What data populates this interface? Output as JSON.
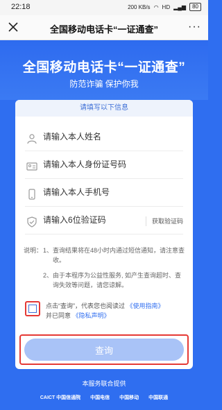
{
  "status": {
    "time": "22:18",
    "speed": "200 KB/s",
    "signal": "HD",
    "battery": "80"
  },
  "nav": {
    "title": "全国移动电话卡“一证通查”",
    "more": "···"
  },
  "hero": {
    "title": "全国移动电话卡“一证通查”",
    "subtitle": "防范诈骗 保护你我"
  },
  "form": {
    "header": "请填写以下信息",
    "name_placeholder": "请输入本人姓名",
    "id_placeholder": "请输入本人身份证号码",
    "phone_placeholder": "请输入本人手机号",
    "code_placeholder": "请输入6位验证码",
    "code_button": "获取验证码"
  },
  "notes": {
    "label": "说明：",
    "items": [
      {
        "num": "1、",
        "text": "查询结果将在48小时内通过短信通知，请注意查收。"
      },
      {
        "num": "2、",
        "text": "由于本程序为公益性服务, 如产生查询超时、查询失效等问题，请您谅解。"
      }
    ]
  },
  "agreement": {
    "prefix": "点击“查询”，代表您也阅读过",
    "guide_link": "《使用指南》",
    "middle": "并已同意",
    "privacy_link": "《隐私声明》"
  },
  "query_button": "查询",
  "footer": {
    "title": "本服务联合提供",
    "logos": [
      "CAICT 中国信通院",
      "中国电信",
      "中国移动",
      "中国联通"
    ]
  },
  "colors": {
    "primary": "#2f6ef0",
    "button": "#a9c3f7",
    "highlight": "#e53935"
  }
}
